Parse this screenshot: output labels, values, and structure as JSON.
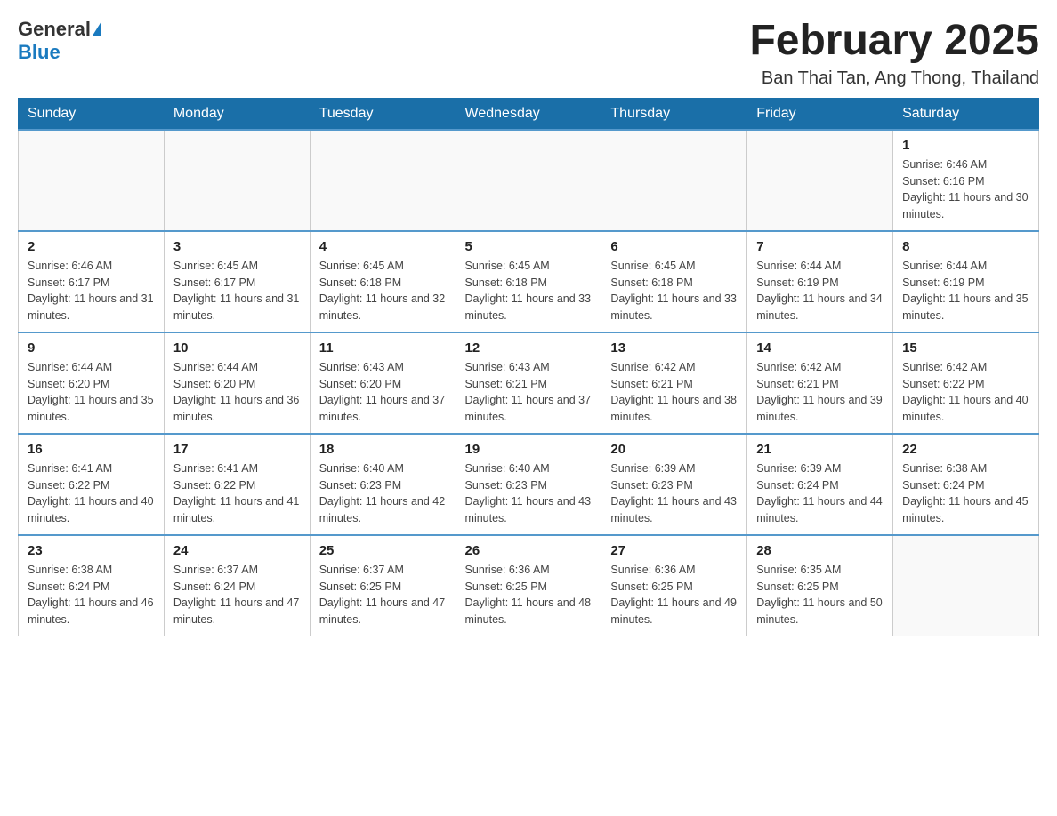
{
  "header": {
    "logo_general": "General",
    "logo_blue": "Blue",
    "month_title": "February 2025",
    "location": "Ban Thai Tan, Ang Thong, Thailand"
  },
  "weekdays": [
    "Sunday",
    "Monday",
    "Tuesday",
    "Wednesday",
    "Thursday",
    "Friday",
    "Saturday"
  ],
  "weeks": [
    [
      {
        "day": "",
        "info": ""
      },
      {
        "day": "",
        "info": ""
      },
      {
        "day": "",
        "info": ""
      },
      {
        "day": "",
        "info": ""
      },
      {
        "day": "",
        "info": ""
      },
      {
        "day": "",
        "info": ""
      },
      {
        "day": "1",
        "info": "Sunrise: 6:46 AM\nSunset: 6:16 PM\nDaylight: 11 hours and 30 minutes."
      }
    ],
    [
      {
        "day": "2",
        "info": "Sunrise: 6:46 AM\nSunset: 6:17 PM\nDaylight: 11 hours and 31 minutes."
      },
      {
        "day": "3",
        "info": "Sunrise: 6:45 AM\nSunset: 6:17 PM\nDaylight: 11 hours and 31 minutes."
      },
      {
        "day": "4",
        "info": "Sunrise: 6:45 AM\nSunset: 6:18 PM\nDaylight: 11 hours and 32 minutes."
      },
      {
        "day": "5",
        "info": "Sunrise: 6:45 AM\nSunset: 6:18 PM\nDaylight: 11 hours and 33 minutes."
      },
      {
        "day": "6",
        "info": "Sunrise: 6:45 AM\nSunset: 6:18 PM\nDaylight: 11 hours and 33 minutes."
      },
      {
        "day": "7",
        "info": "Sunrise: 6:44 AM\nSunset: 6:19 PM\nDaylight: 11 hours and 34 minutes."
      },
      {
        "day": "8",
        "info": "Sunrise: 6:44 AM\nSunset: 6:19 PM\nDaylight: 11 hours and 35 minutes."
      }
    ],
    [
      {
        "day": "9",
        "info": "Sunrise: 6:44 AM\nSunset: 6:20 PM\nDaylight: 11 hours and 35 minutes."
      },
      {
        "day": "10",
        "info": "Sunrise: 6:44 AM\nSunset: 6:20 PM\nDaylight: 11 hours and 36 minutes."
      },
      {
        "day": "11",
        "info": "Sunrise: 6:43 AM\nSunset: 6:20 PM\nDaylight: 11 hours and 37 minutes."
      },
      {
        "day": "12",
        "info": "Sunrise: 6:43 AM\nSunset: 6:21 PM\nDaylight: 11 hours and 37 minutes."
      },
      {
        "day": "13",
        "info": "Sunrise: 6:42 AM\nSunset: 6:21 PM\nDaylight: 11 hours and 38 minutes."
      },
      {
        "day": "14",
        "info": "Sunrise: 6:42 AM\nSunset: 6:21 PM\nDaylight: 11 hours and 39 minutes."
      },
      {
        "day": "15",
        "info": "Sunrise: 6:42 AM\nSunset: 6:22 PM\nDaylight: 11 hours and 40 minutes."
      }
    ],
    [
      {
        "day": "16",
        "info": "Sunrise: 6:41 AM\nSunset: 6:22 PM\nDaylight: 11 hours and 40 minutes."
      },
      {
        "day": "17",
        "info": "Sunrise: 6:41 AM\nSunset: 6:22 PM\nDaylight: 11 hours and 41 minutes."
      },
      {
        "day": "18",
        "info": "Sunrise: 6:40 AM\nSunset: 6:23 PM\nDaylight: 11 hours and 42 minutes."
      },
      {
        "day": "19",
        "info": "Sunrise: 6:40 AM\nSunset: 6:23 PM\nDaylight: 11 hours and 43 minutes."
      },
      {
        "day": "20",
        "info": "Sunrise: 6:39 AM\nSunset: 6:23 PM\nDaylight: 11 hours and 43 minutes."
      },
      {
        "day": "21",
        "info": "Sunrise: 6:39 AM\nSunset: 6:24 PM\nDaylight: 11 hours and 44 minutes."
      },
      {
        "day": "22",
        "info": "Sunrise: 6:38 AM\nSunset: 6:24 PM\nDaylight: 11 hours and 45 minutes."
      }
    ],
    [
      {
        "day": "23",
        "info": "Sunrise: 6:38 AM\nSunset: 6:24 PM\nDaylight: 11 hours and 46 minutes."
      },
      {
        "day": "24",
        "info": "Sunrise: 6:37 AM\nSunset: 6:24 PM\nDaylight: 11 hours and 47 minutes."
      },
      {
        "day": "25",
        "info": "Sunrise: 6:37 AM\nSunset: 6:25 PM\nDaylight: 11 hours and 47 minutes."
      },
      {
        "day": "26",
        "info": "Sunrise: 6:36 AM\nSunset: 6:25 PM\nDaylight: 11 hours and 48 minutes."
      },
      {
        "day": "27",
        "info": "Sunrise: 6:36 AM\nSunset: 6:25 PM\nDaylight: 11 hours and 49 minutes."
      },
      {
        "day": "28",
        "info": "Sunrise: 6:35 AM\nSunset: 6:25 PM\nDaylight: 11 hours and 50 minutes."
      },
      {
        "day": "",
        "info": ""
      }
    ]
  ]
}
